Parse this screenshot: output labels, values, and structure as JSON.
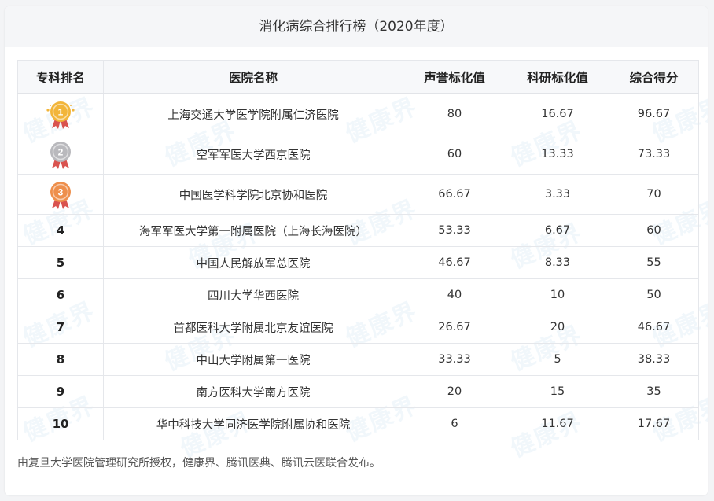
{
  "title": "消化病综合排行榜（2020年度）",
  "watermark_text": "健康界",
  "columns": [
    "专科排名",
    "医院名称",
    "声誉标化值",
    "科研标化值",
    "综合得分"
  ],
  "rows": [
    {
      "rank": "1",
      "medal": "gold",
      "hospital": "上海交通大学医学院附属仁济医院",
      "reputation": "80",
      "research": "16.67",
      "score": "96.67"
    },
    {
      "rank": "2",
      "medal": "silver",
      "hospital": "空军军医大学西京医院",
      "reputation": "60",
      "research": "13.33",
      "score": "73.33"
    },
    {
      "rank": "3",
      "medal": "bronze",
      "hospital": "中国医学科学院北京协和医院",
      "reputation": "66.67",
      "research": "3.33",
      "score": "70"
    },
    {
      "rank": "4",
      "medal": "",
      "hospital": "海军军医大学第一附属医院（上海长海医院）",
      "reputation": "53.33",
      "research": "6.67",
      "score": "60"
    },
    {
      "rank": "5",
      "medal": "",
      "hospital": "中国人民解放军总医院",
      "reputation": "46.67",
      "research": "8.33",
      "score": "55"
    },
    {
      "rank": "6",
      "medal": "",
      "hospital": "四川大学华西医院",
      "reputation": "40",
      "research": "10",
      "score": "50"
    },
    {
      "rank": "7",
      "medal": "",
      "hospital": "首都医科大学附属北京友谊医院",
      "reputation": "26.67",
      "research": "20",
      "score": "46.67"
    },
    {
      "rank": "8",
      "medal": "",
      "hospital": "中山大学附属第一医院",
      "reputation": "33.33",
      "research": "5",
      "score": "38.33"
    },
    {
      "rank": "9",
      "medal": "",
      "hospital": "南方医科大学南方医院",
      "reputation": "20",
      "research": "15",
      "score": "35"
    },
    {
      "rank": "10",
      "medal": "",
      "hospital": "华中科技大学同济医学院附属协和医院",
      "reputation": "6",
      "research": "11.67",
      "score": "17.67"
    }
  ],
  "footer": "由复旦大学医院管理研究所授权，健康界、腾讯医典、腾讯云医联合发布。",
  "colors": {
    "gold": "#f2b53a",
    "silver": "#b9b9bd",
    "bronze": "#ee8f4c",
    "ribbon": "#d9534f"
  }
}
